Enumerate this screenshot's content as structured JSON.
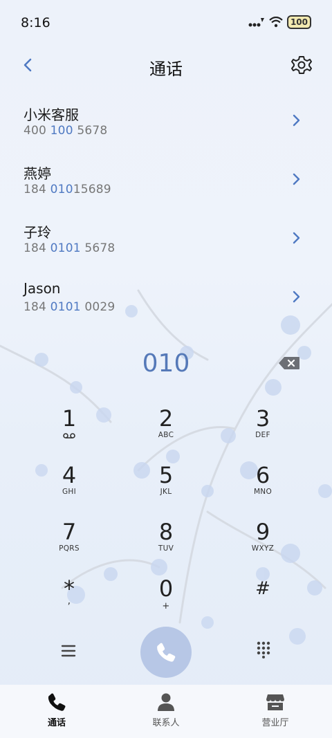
{
  "status": {
    "time": "8:16",
    "battery": "100"
  },
  "header": {
    "title": "通话"
  },
  "contacts": [
    {
      "name": "小米客服",
      "num_pre": "400 ",
      "num_hl": "100",
      "num_post": " 5678"
    },
    {
      "name": "燕婷",
      "num_pre": "184 ",
      "num_hl": "010",
      "num_post": "15689"
    },
    {
      "name": "子玲",
      "num_pre": "184 ",
      "num_hl": "0101",
      "num_post": " 5678"
    },
    {
      "name": "Jason",
      "num_pre": "184 ",
      "num_hl": "0101",
      "num_post": " 0029"
    }
  ],
  "dialer": {
    "value": "010"
  },
  "keys": [
    {
      "digit": "1",
      "letters": ""
    },
    {
      "digit": "2",
      "letters": "ABC"
    },
    {
      "digit": "3",
      "letters": "DEF"
    },
    {
      "digit": "4",
      "letters": "GHI"
    },
    {
      "digit": "5",
      "letters": "JKL"
    },
    {
      "digit": "6",
      "letters": "MNO"
    },
    {
      "digit": "7",
      "letters": "PQRS"
    },
    {
      "digit": "8",
      "letters": "TUV"
    },
    {
      "digit": "9",
      "letters": "WXYZ"
    },
    {
      "digit": "*",
      "letters": ","
    },
    {
      "digit": "0",
      "letters": "+"
    },
    {
      "digit": "#",
      "letters": ""
    }
  ],
  "tabs": [
    {
      "label": "通话",
      "icon": "phone-icon",
      "active": true
    },
    {
      "label": "联系人",
      "icon": "person-icon",
      "active": false
    },
    {
      "label": "营业厅",
      "icon": "store-icon",
      "active": false
    }
  ],
  "colors": {
    "accent": "#5579b8",
    "call_button": "#b7c7e6"
  }
}
